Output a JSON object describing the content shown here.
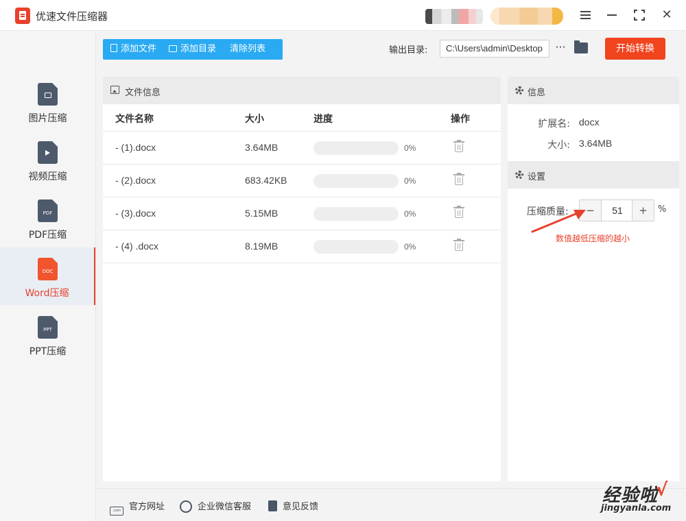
{
  "app": {
    "title": "优速文件压缩器"
  },
  "sidebar": {
    "items": [
      {
        "label": "图片压缩",
        "icon": "image-icon",
        "active": false
      },
      {
        "label": "视频压缩",
        "icon": "video-icon",
        "active": false
      },
      {
        "label": "PDF压缩",
        "icon": "pdf-file-icon",
        "tag": "PDF",
        "active": false
      },
      {
        "label": "Word压缩",
        "icon": "word-file-icon",
        "tag": "DOC",
        "active": true
      },
      {
        "label": "PPT压缩",
        "icon": "ppt-file-icon",
        "tag": "PPT",
        "active": false
      }
    ]
  },
  "toolbar": {
    "add_file": "添加文件",
    "add_dir": "添加目录",
    "clear_list": "清除列表",
    "output_label": "输出目录:",
    "output_path": "C:\\Users\\admin\\Desktop",
    "more": "···",
    "start": "开始转换"
  },
  "file_panel": {
    "title": "文件信息",
    "columns": {
      "name": "文件名称",
      "size": "大小",
      "progress": "进度",
      "action": "操作"
    },
    "rows": [
      {
        "name": "- (1).docx",
        "size": "3.64MB",
        "progress": 0,
        "progress_text": "0%"
      },
      {
        "name": "- (2).docx",
        "size": "683.42KB",
        "progress": 0,
        "progress_text": "0%"
      },
      {
        "name": "- (3).docx",
        "size": "5.15MB",
        "progress": 0,
        "progress_text": "0%"
      },
      {
        "name": "- (4) .docx",
        "size": "8.19MB",
        "progress": 0,
        "progress_text": "0%"
      }
    ]
  },
  "info": {
    "title": "信息",
    "ext_label": "扩展名:",
    "ext_value": "docx",
    "size_label": "大小:",
    "size_value": "3.64MB"
  },
  "settings": {
    "title": "设置",
    "quality_label": "压缩质量:",
    "minus": "−",
    "plus": "+",
    "quality_value": "51",
    "percent": "%",
    "hint": "数值越低压缩的越小"
  },
  "footer": {
    "website": "官方网址",
    "website_icon_text": ".com",
    "wechat": "企业微信客服",
    "feedback": "意见反馈"
  },
  "watermark": {
    "big": "经验啦",
    "check": "√",
    "small": "jingyanla.com"
  },
  "colors": {
    "accent": "#e8412c",
    "toolbar": "#29aaf3",
    "start": "#f0441f"
  }
}
